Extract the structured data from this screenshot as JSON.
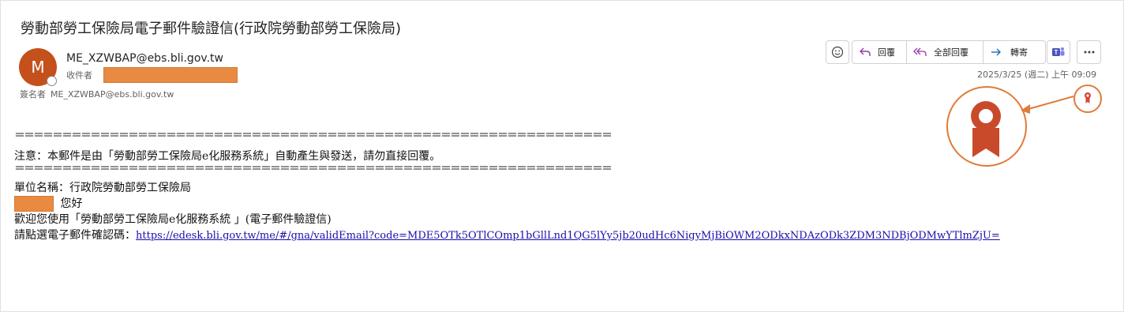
{
  "subject": "勞動部勞工保險局電子郵件驗證信(行政院勞動部勞工保險局)",
  "sender": {
    "initial": "M",
    "address": "ME_XZWBAP@ebs.bli.gov.tw"
  },
  "to_label": "收件者",
  "signed_label": "簽名者",
  "signed_address": "ME_XZWBAP@ebs.bli.gov.tw",
  "toolbar": {
    "reply": "回覆",
    "reply_all": "全部回覆",
    "forward": "轉寄"
  },
  "date": "2025/3/25 (週二) 上午 09:09",
  "body": {
    "separator": "＝＝＝＝＝＝＝＝＝＝＝＝＝＝＝＝＝＝＝＝＝＝＝＝＝＝＝＝＝＝＝＝＝＝＝＝＝＝＝＝＝＝＝＝＝＝＝＝＝＝＝＝＝＝＝＝＝＝＝＝＝＝＝",
    "notice": "注意：本郵件是由「勞動部勞工保險局e化服務系統」自動產生與發送，請勿直接回覆。",
    "unit": "單位名稱：行政院勞動部勞工保險局",
    "greeting": "您好",
    "welcome": "歡迎您使用「勞動部勞工保險局e化服務系統 」(電子郵件驗證信)",
    "click_prompt": "請點選電子郵件確認碼：",
    "link": "https://edesk.bli.gov.tw/me/#/gna/validEmail?code=MDE5OTk5OTlCOmp1bGllLnd1QG5lYy5jb20udHc6NigyMjBiOWM2ODkxNDAzODk3ZDM3NDBjODMwYTlmZjU="
  },
  "colors": {
    "avatar": "#c4501c",
    "redact": "#e98a43",
    "annotation": "#e07b39",
    "link": "#1a0dab"
  }
}
